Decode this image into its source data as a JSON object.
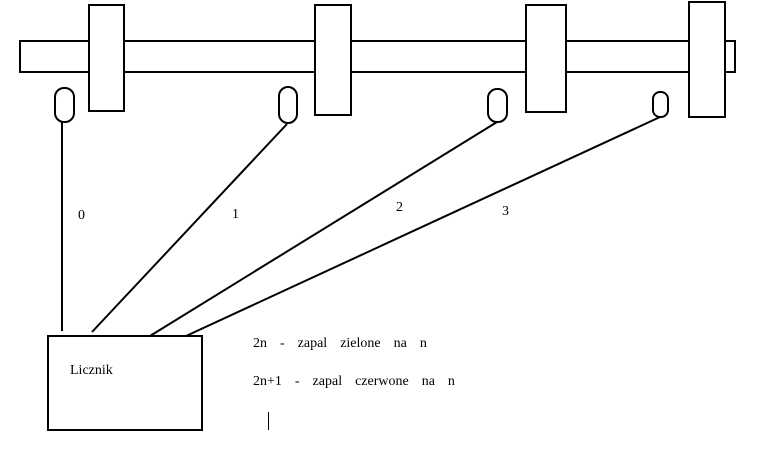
{
  "diagram": {
    "counter_label": "Licznik",
    "line_labels": [
      "0",
      "1",
      "2",
      "3"
    ],
    "notes": [
      "2n  -  zapal  zielone  na  n",
      "2n+1  -  zapal  czerwone  na  n"
    ]
  },
  "colors": {
    "stroke": "#000000",
    "background": "#ffffff"
  }
}
